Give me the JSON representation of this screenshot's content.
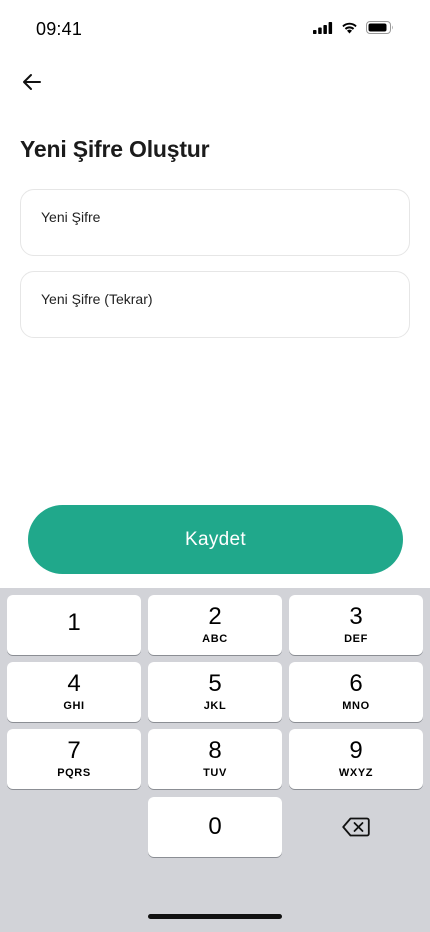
{
  "status": {
    "time": "09:41"
  },
  "header": {
    "title": "Yeni Şifre Oluştur"
  },
  "form": {
    "new_password_label": "Yeni Şifre",
    "new_password_value": "",
    "confirm_password_label": "Yeni Şifre (Tekrar)",
    "confirm_password_value": ""
  },
  "actions": {
    "save_label": "Kaydet"
  },
  "keyboard": {
    "keys": [
      {
        "digit": "1",
        "letters": ""
      },
      {
        "digit": "2",
        "letters": "ABC"
      },
      {
        "digit": "3",
        "letters": "DEF"
      },
      {
        "digit": "4",
        "letters": "GHI"
      },
      {
        "digit": "5",
        "letters": "JKL"
      },
      {
        "digit": "6",
        "letters": "MNO"
      },
      {
        "digit": "7",
        "letters": "PQRS"
      },
      {
        "digit": "8",
        "letters": "TUV"
      },
      {
        "digit": "9",
        "letters": "WXYZ"
      },
      {
        "digit": "0",
        "letters": ""
      }
    ]
  },
  "colors": {
    "accent": "#20a88b",
    "keyboard_bg": "#d2d3d8"
  },
  "icons": {
    "back": "arrow-left-icon",
    "delete": "backspace-icon"
  }
}
